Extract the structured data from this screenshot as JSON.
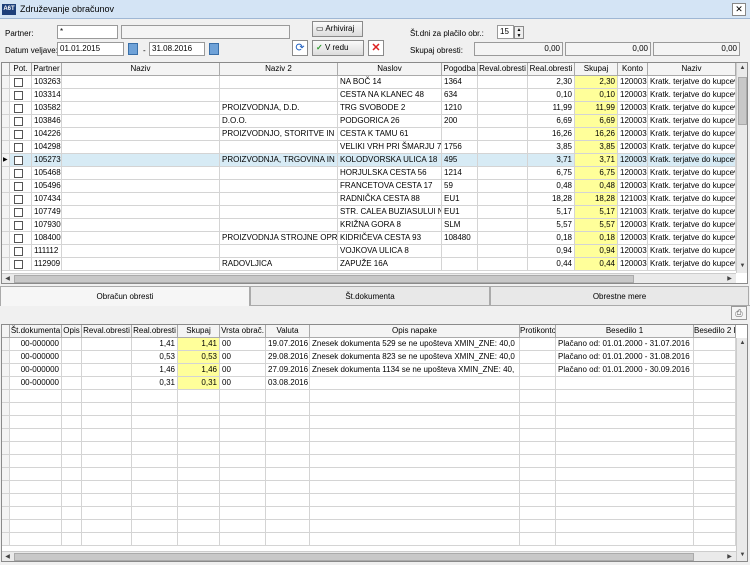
{
  "window": {
    "title": "Združevanje obračunov",
    "app_icon": "A6T",
    "close_glyph": "✕"
  },
  "form": {
    "partner_label": "Partner:",
    "partner_value": "*",
    "partner_name_value": "",
    "datum_label": "Datum veljave:",
    "date_from": "01.01.2015",
    "date_sep": "-",
    "date_to": "31.08.2016",
    "archive_label": "Arhiviraj",
    "ok_label": "V redu",
    "stdni_label": "Št.dni za plačilo obr.:",
    "stdni_value": "15",
    "skupaj_label": "Skupaj obresti:",
    "totals": [
      "0,00",
      "0,00",
      "0,00"
    ]
  },
  "upper_grid": {
    "headers": [
      "Pot.",
      "Partner",
      "Naziv",
      "Naziv 2",
      "Naslov",
      "Pogodba",
      "Reval.obresti",
      "Real.obresti",
      "Skupaj",
      "Konto",
      "Naziv"
    ],
    "rows": [
      {
        "partner": "103263",
        "naziv": "",
        "naziv2": "",
        "naslov": "NA BOČ 14",
        "pogodba": "1364",
        "reval": "",
        "real": "2,30",
        "skupaj": "2,30",
        "konto": "120003",
        "knaziv": "Kratk. terjatve do kupcev"
      },
      {
        "partner": "103314",
        "naziv": "",
        "naziv2": "",
        "naslov": "CESTA NA KLANEC 48",
        "pogodba": "634",
        "reval": "",
        "real": "0,10",
        "skupaj": "0,10",
        "konto": "120003",
        "knaziv": "Kratk. terjatve do kupcev"
      },
      {
        "partner": "103582",
        "naziv": "",
        "naziv2": "PROIZVODNJA, D.D.",
        "naslov": "TRG SVOBODE 2",
        "pogodba": "1210",
        "reval": "",
        "real": "11,99",
        "skupaj": "11,99",
        "konto": "120003",
        "knaziv": "Kratk. terjatve do kupcev"
      },
      {
        "partner": "103846",
        "naziv": "",
        "naziv2": "D.O.O.",
        "naslov": "PODGORICA 26",
        "pogodba": "200",
        "reval": "",
        "real": "6,69",
        "skupaj": "6,69",
        "konto": "120003",
        "knaziv": "Kratk. terjatve do kupcev"
      },
      {
        "partner": "104226",
        "naziv": "",
        "naziv2": "PROIZVODNJO, STORITVE IN",
        "naslov": "CESTA K TAMU 61",
        "pogodba": "",
        "reval": "",
        "real": "16,26",
        "skupaj": "16,26",
        "konto": "120003",
        "knaziv": "Kratk. terjatve do kupcev"
      },
      {
        "partner": "104298",
        "naziv": "",
        "naziv2": "",
        "naslov": "VELIKI VRH PRI ŠMARJU 7",
        "pogodba": "1756",
        "reval": "",
        "real": "3,85",
        "skupaj": "3,85",
        "konto": "120003",
        "knaziv": "Kratk. terjatve do kupcev"
      },
      {
        "partner": "105273",
        "naziv": "",
        "naziv2": "PROIZVODNJA, TRGOVINA IN",
        "naslov": "KOLODVORSKA ULICA 18",
        "pogodba": "495",
        "reval": "",
        "real": "3,71",
        "skupaj": "3,71",
        "konto": "120003",
        "knaziv": "Kratk. terjatve do kupcev"
      },
      {
        "partner": "105468",
        "naziv": "",
        "naziv2": "",
        "naslov": "HORJULSKA CESTA 56",
        "pogodba": "1214",
        "reval": "",
        "real": "6,75",
        "skupaj": "6,75",
        "konto": "120003",
        "knaziv": "Kratk. terjatve do kupcev"
      },
      {
        "partner": "105496",
        "naziv": "",
        "naziv2": "",
        "naslov": "FRANCETOVA CESTA 17",
        "pogodba": "59",
        "reval": "",
        "real": "0,48",
        "skupaj": "0,48",
        "konto": "120003",
        "knaziv": "Kratk. terjatve do kupcev"
      },
      {
        "partner": "107434",
        "naziv": "",
        "naziv2": "",
        "naslov": "RADNIČKA CESTA 88",
        "pogodba": "EU1",
        "reval": "",
        "real": "18,28",
        "skupaj": "18,28",
        "konto": "121003",
        "knaziv": "Kratk. terjatve do kupcev"
      },
      {
        "partner": "107749",
        "naziv": "",
        "naziv2": "",
        "naslov": "STR. CALEA BUZIASULUI N",
        "pogodba": "EU1",
        "reval": "",
        "real": "5,17",
        "skupaj": "5,17",
        "konto": "121003",
        "knaziv": "Kratk. terjatve do kupcev"
      },
      {
        "partner": "107930",
        "naziv": "",
        "naziv2": "",
        "naslov": "KRIŽNA GORA 8",
        "pogodba": "SLM",
        "reval": "",
        "real": "5,57",
        "skupaj": "5,57",
        "konto": "120003",
        "knaziv": "Kratk. terjatve do kupcev"
      },
      {
        "partner": "108400",
        "naziv": "",
        "naziv2": "PROIZVODNJA STROJNE OPR",
        "naslov": "KIDRIČEVA CESTA 93",
        "pogodba": "108480",
        "reval": "",
        "real": "0,18",
        "skupaj": "0,18",
        "konto": "120003",
        "knaziv": "Kratk. terjatve do kupcev"
      },
      {
        "partner": "111112",
        "naziv": "",
        "naziv2": "",
        "naslov": "VOJKOVA ULICA 8",
        "pogodba": "",
        "reval": "",
        "real": "0,94",
        "skupaj": "0,94",
        "konto": "120003",
        "knaziv": "Kratk. terjatve do kupcev"
      },
      {
        "partner": "112909",
        "naziv": "",
        "naziv2": "RADOVLJICA",
        "naslov": "ZAPUŽE 16A",
        "pogodba": "",
        "reval": "",
        "real": "0,44",
        "skupaj": "0,44",
        "konto": "120003",
        "knaziv": "Kratk. terjatve do kupcev"
      }
    ],
    "selected_index": 6
  },
  "tabs": [
    "Obračun obresti",
    "Št.dokumenta",
    "Obrestne mere"
  ],
  "lower_grid": {
    "headers": [
      "Št.dokumenta",
      "Opis",
      "Reval.obresti",
      "Real.obresti",
      "Skupaj",
      "Vrsta obrač.",
      "Valuta",
      "Opis napake",
      "Protikonto",
      "Besedilo 1",
      "Besedilo 2 B"
    ],
    "rows": [
      {
        "stdok": "00-000000",
        "opis": "",
        "reval": "",
        "real": "1,41",
        "skupaj": "1,41",
        "vrsta": "00",
        "valuta": "19.07.2016",
        "napaka": "Znesek dokumenta 529 se ne upošteva XMIN_ZNE: 40,0",
        "protikonto": "",
        "bes1": "Plačano od: 01.01.2000 - 31.07.2016",
        "bes2": ""
      },
      {
        "stdok": "00-000000",
        "opis": "",
        "reval": "",
        "real": "0,53",
        "skupaj": "0,53",
        "vrsta": "00",
        "valuta": "29.08.2016",
        "napaka": "Znesek dokumenta 823 se ne upošteva XMIN_ZNE: 40,0",
        "protikonto": "",
        "bes1": "Plačano od: 01.01.2000 - 31.08.2016",
        "bes2": ""
      },
      {
        "stdok": "00-000000",
        "opis": "",
        "reval": "",
        "real": "1,46",
        "skupaj": "1,46",
        "vrsta": "00",
        "valuta": "27.09.2016",
        "napaka": "Znesek dokumenta 1134 se ne upošteva XMIN_ZNE: 40,",
        "protikonto": "",
        "bes1": "Plačano od: 01.01.2000 - 30.09.2016",
        "bes2": ""
      },
      {
        "stdok": "00-000000",
        "opis": "",
        "reval": "",
        "real": "0,31",
        "skupaj": "0,31",
        "vrsta": "00",
        "valuta": "03.08.2016",
        "napaka": "",
        "protikonto": "",
        "bes1": "",
        "bes2": ""
      }
    ]
  },
  "colors": {
    "highlight": "#ffff9a",
    "selected_row": "#d7ebf5"
  }
}
